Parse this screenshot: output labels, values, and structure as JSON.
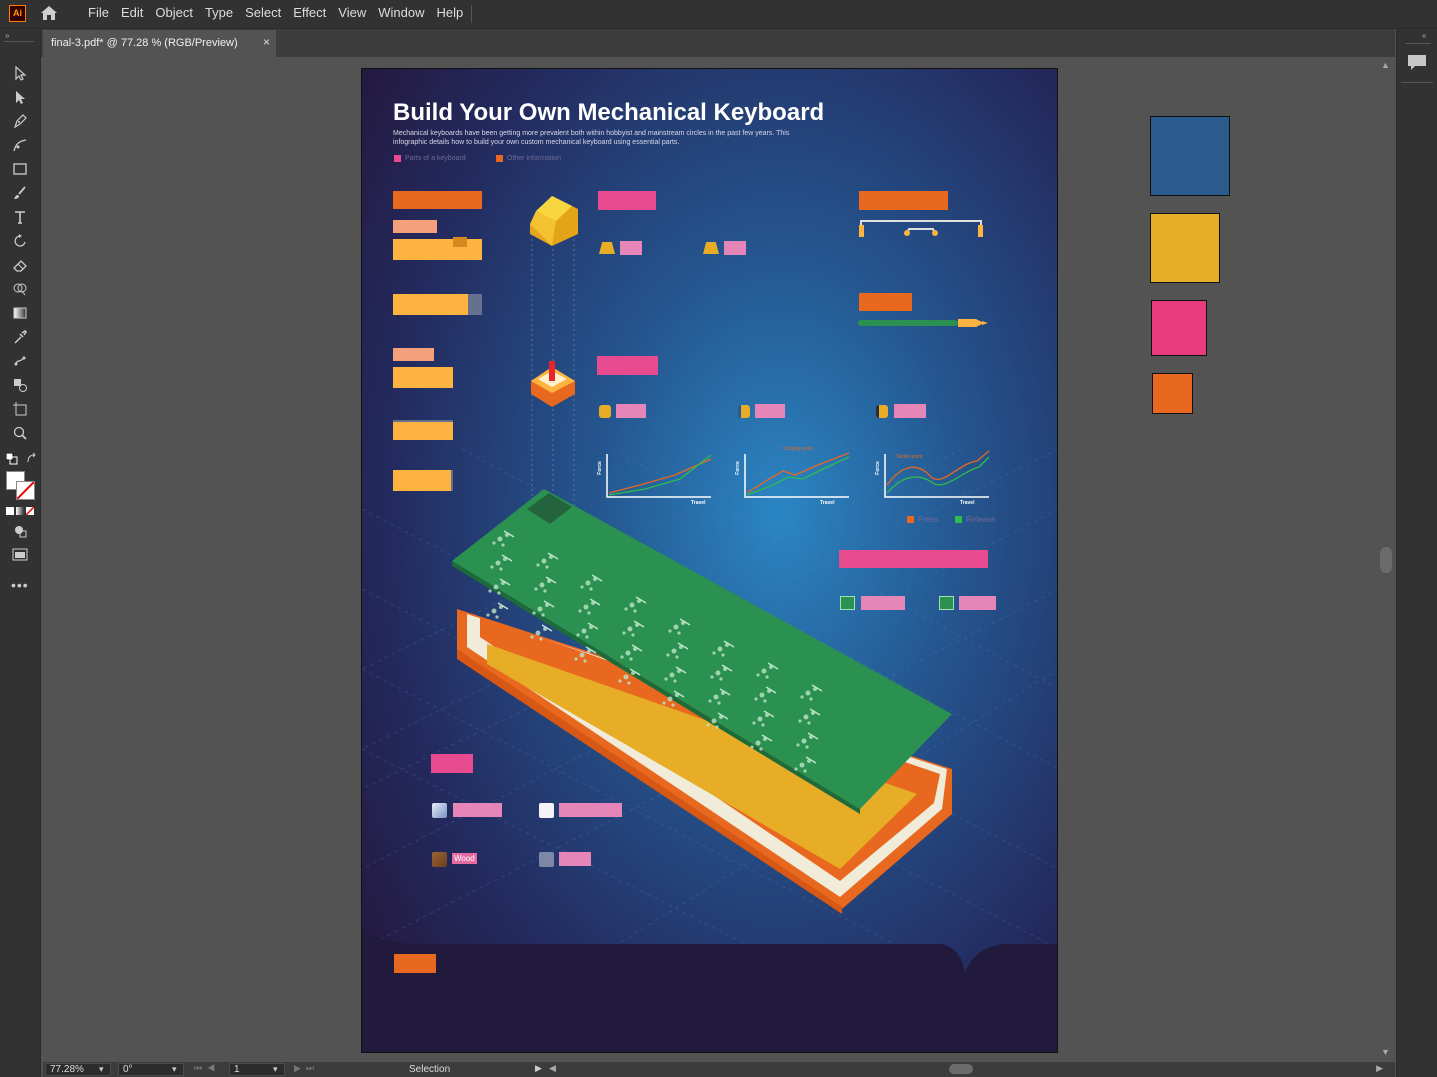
{
  "app": {
    "logo_text": "Ai"
  },
  "menu": [
    "File",
    "Edit",
    "Object",
    "Type",
    "Select",
    "Effect",
    "View",
    "Window",
    "Help"
  ],
  "document_tab": {
    "title": "final-3.pdf* @ 77.28 % (RGB/Preview)",
    "close": "×"
  },
  "tools": [
    "selection-tool",
    "direct-selection-tool",
    "pen-tool",
    "curvature-tool",
    "rectangle-tool",
    "paintbrush-tool",
    "type-tool",
    "rotate-tool",
    "eraser-tool",
    "shape-builder-tool",
    "gradient-tool",
    "eyedropper-tool",
    "puppet-warp-tool",
    "live-paint-tool",
    "artboard-tool",
    "zoom-tool"
  ],
  "status_bar": {
    "zoom": "77.28%",
    "rotation": "0°",
    "artboard_number": "1",
    "current_tool": "Selection"
  },
  "artwork": {
    "title": "Build Your Own Mechanical Keyboard",
    "subtitle": "Mechanical keyboards have been getting more prevalent both within hobbyist and mainstream circles in the past few years. This infographic details how to build your own custom mechanical keyboard using essential parts.",
    "legend_parts": "Parts of a keyboard",
    "legend_other": "Other information",
    "chart1": {
      "ylabel": "Force",
      "xlabel": "Travel"
    },
    "chart2": {
      "ylabel": "Force",
      "xlabel": "Travel",
      "annotation": "Clicking point"
    },
    "chart3": {
      "ylabel": "Force",
      "xlabel": "Travel",
      "annotation": "Tactile point"
    },
    "chart_legend_press": "Press",
    "chart_legend_release": "Release",
    "material_wood": "Wood"
  },
  "colors": {
    "orange": "#e8681f",
    "yellow": "#fdb33f",
    "pink": "#e84a8f",
    "light_pink": "#e685b7",
    "salmon": "#f5a07c",
    "green_pcb": "#2a9150",
    "swatch_blue": "#2a5b8c",
    "swatch_yellow": "#e7ad27",
    "swatch_pink": "#e83c7d",
    "swatch_orange": "#e8681f"
  }
}
